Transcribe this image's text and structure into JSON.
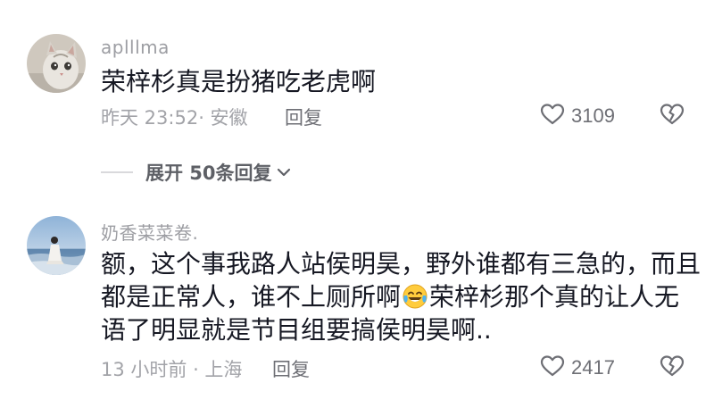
{
  "comments": [
    {
      "username": "aplllma",
      "text_line1": "荣梓杉真是扮猪吃老虎啊",
      "time_location": "昨天 23:52· 安徽",
      "reply_label": "回复",
      "like_count": "3109"
    },
    {
      "username": "奶香菜菜卷.",
      "text_line1": "额，这个事我路人站侯明昊，野外谁都有三急的，而且",
      "text_line2_a": "都是正常人，谁不上厕所啊",
      "text_line2_b": "荣梓杉那个真的让人无",
      "text_line3": "语了明显就是节目组要搞侯明昊啊..",
      "time_location": "13 小时前 · 上海",
      "reply_label": "回复",
      "like_count": "2417"
    }
  ],
  "expand_replies": {
    "label": "展开 50条回复"
  },
  "icons": {
    "like": "heart-outline-icon",
    "dislike": "broken-heart-icon",
    "expand": "chevron-down-icon",
    "emoji": "laughing-tears-emoji"
  },
  "colors": {
    "primary_text": "#161823",
    "secondary_text": "#a2a3a8",
    "action_text": "#6e6f75"
  }
}
